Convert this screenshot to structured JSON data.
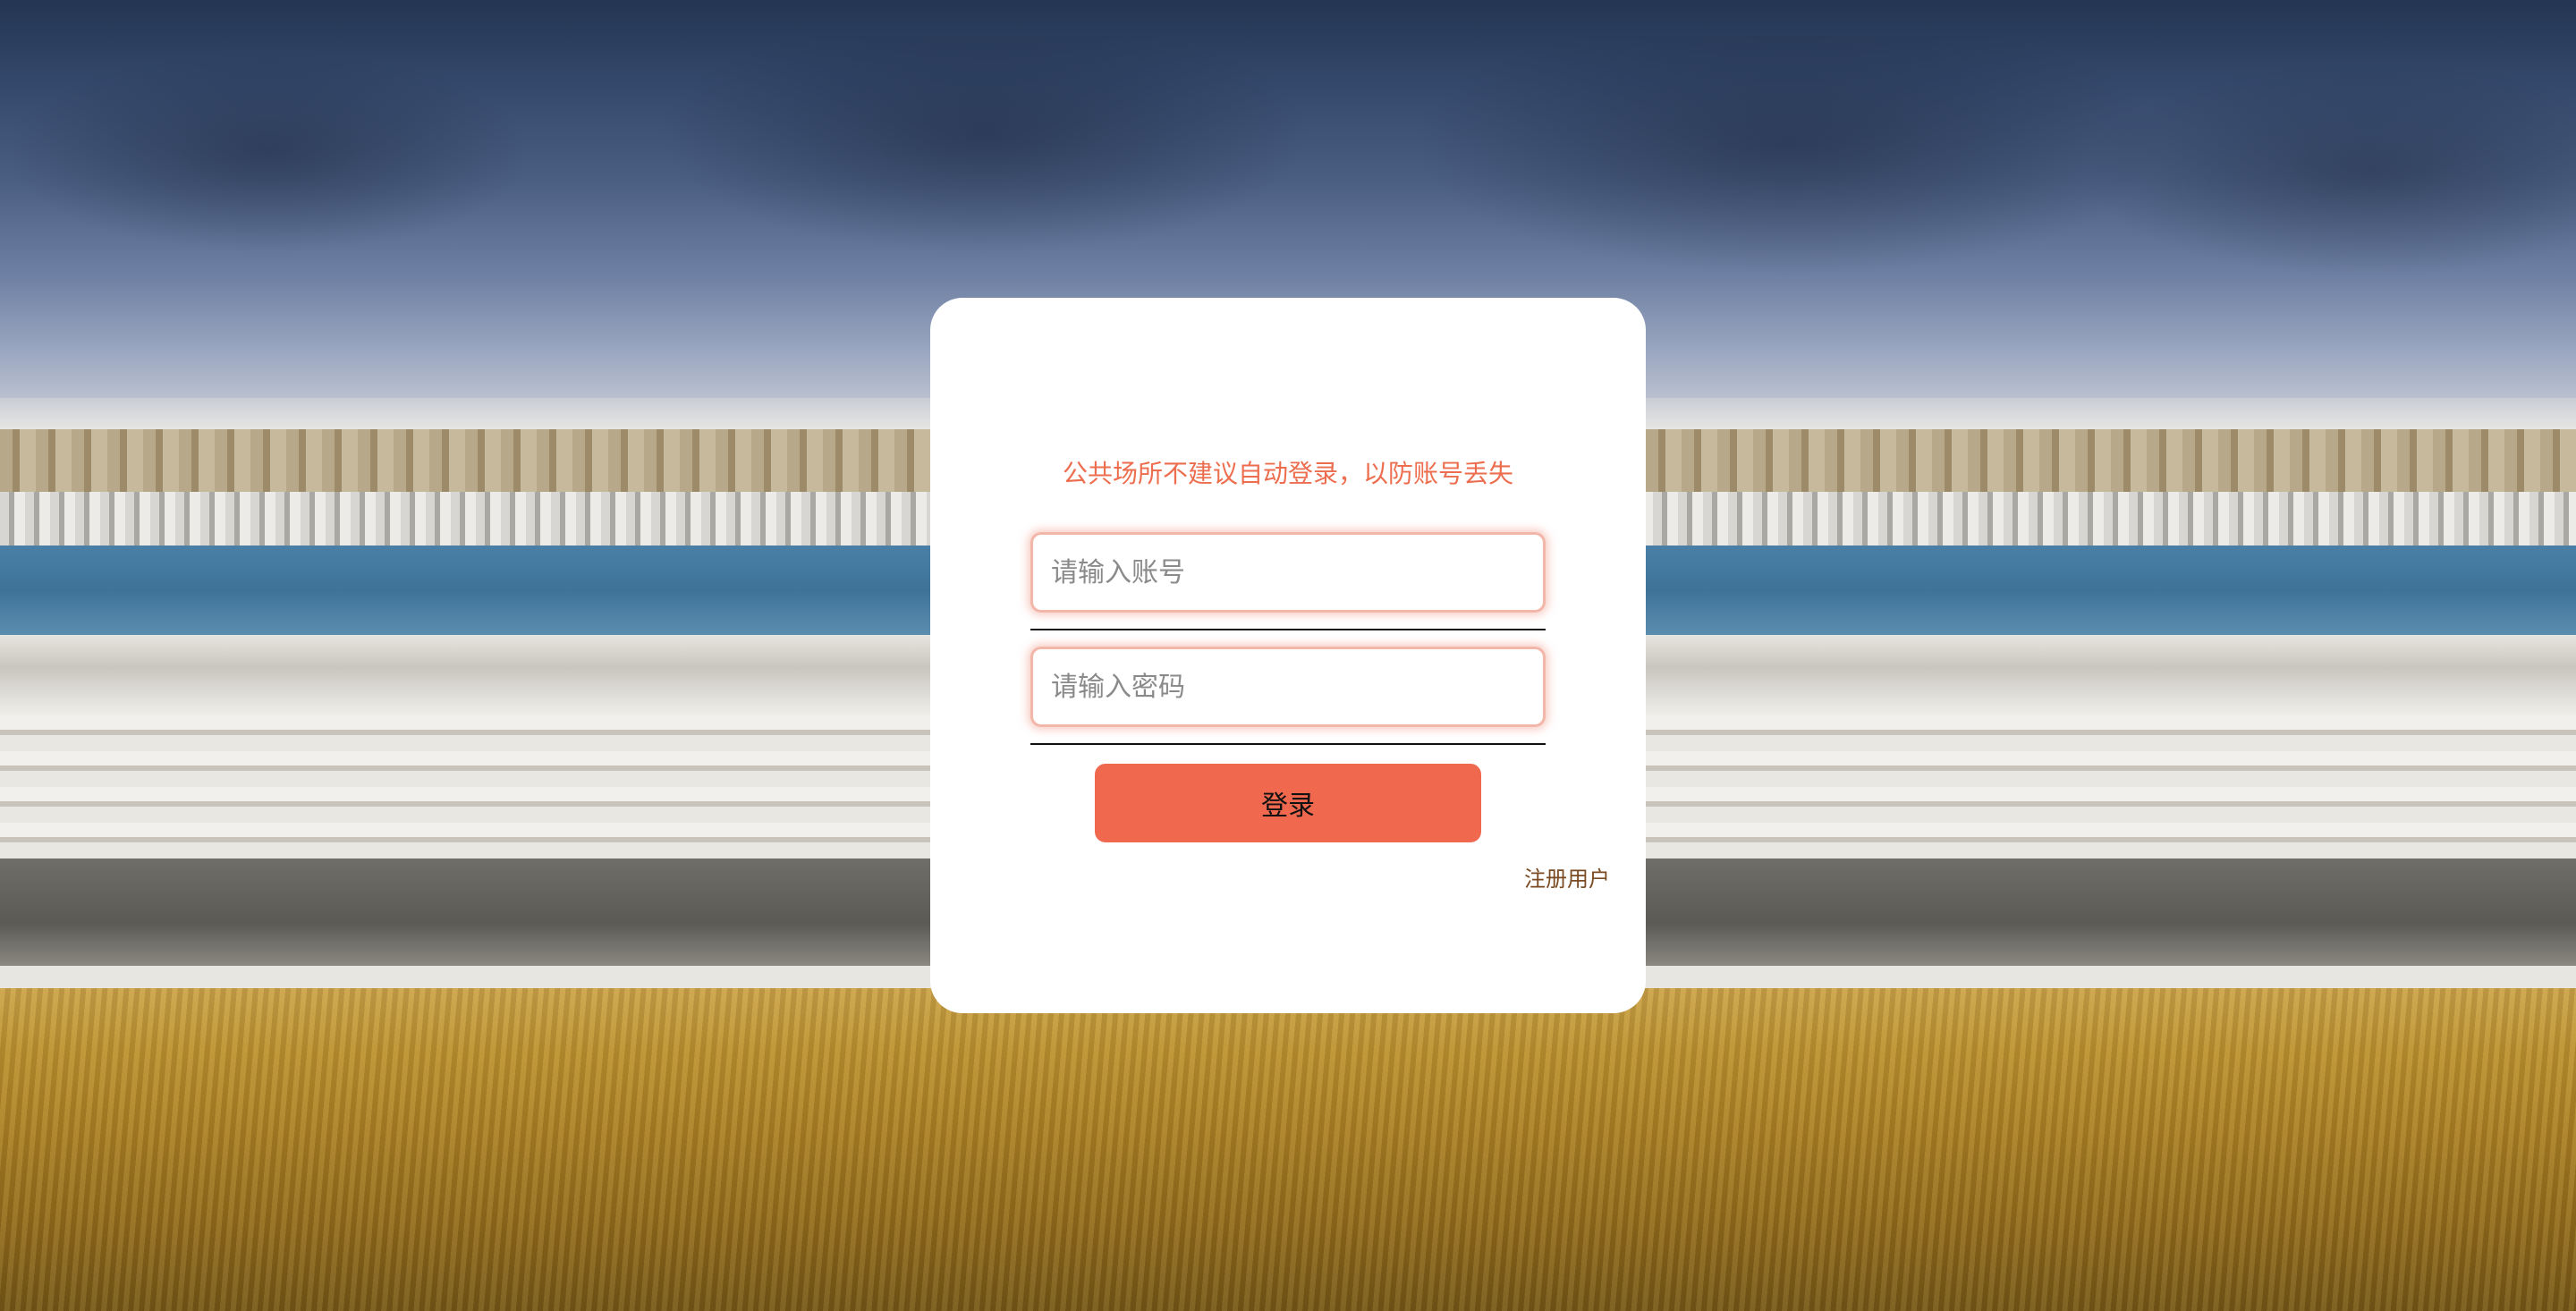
{
  "login": {
    "notice": "公共场所不建议自动登录，以防账号丢失",
    "account_placeholder": "请输入账号",
    "password_placeholder": "请输入密码",
    "login_label": "登录",
    "register_label": "注册用户"
  },
  "colors": {
    "accent": "#f0694f",
    "notice_text": "#ec6e4f",
    "register_text": "#7a4a22",
    "card_bg": "#ffffff"
  }
}
